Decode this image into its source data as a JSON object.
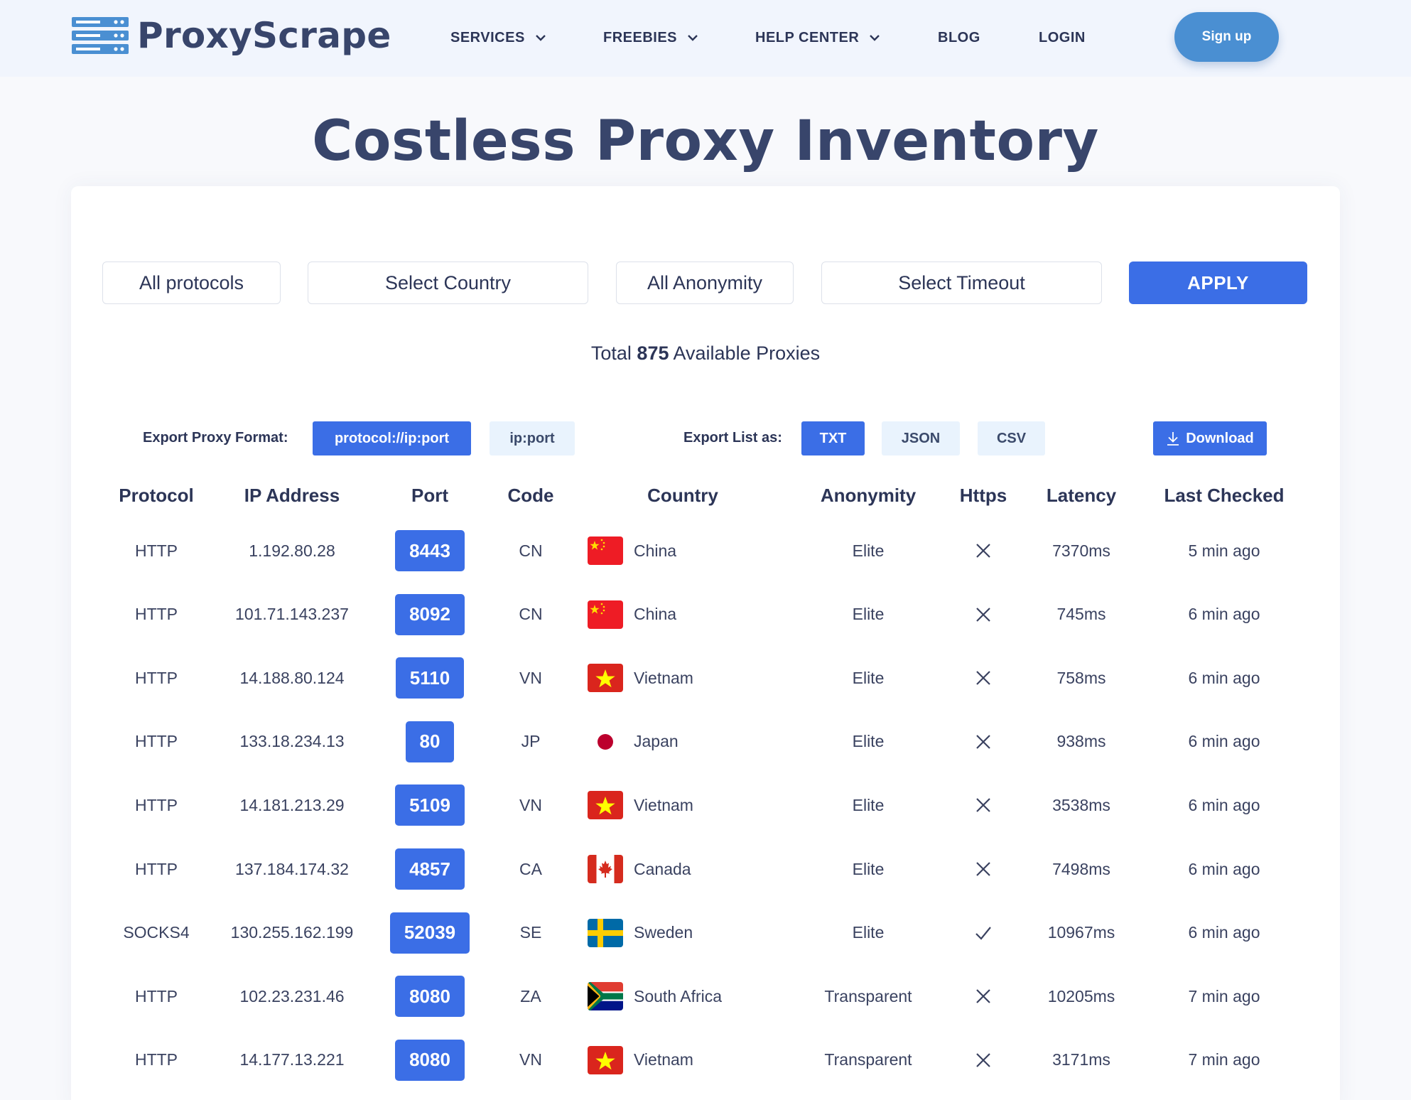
{
  "header": {
    "brand": "ProxyScrape",
    "nav": [
      {
        "label": "SERVICES",
        "has_dropdown": true
      },
      {
        "label": "FREEBIES",
        "has_dropdown": true
      },
      {
        "label": "HELP CENTER",
        "has_dropdown": true
      },
      {
        "label": "BLOG",
        "has_dropdown": false
      },
      {
        "label": "LOGIN",
        "has_dropdown": false
      }
    ],
    "signup_label": "Sign up"
  },
  "page": {
    "title": "Costless Proxy Inventory"
  },
  "filters": {
    "protocol": "All protocols",
    "country": "Select Country",
    "anonymity": "All Anonymity",
    "timeout": "Select Timeout",
    "apply_label": "APPLY"
  },
  "summary": {
    "prefix": "Total",
    "count": "875",
    "suffix": "Available Proxies"
  },
  "export": {
    "format_label": "Export Proxy Format:",
    "formats": [
      {
        "label": "protocol://ip:port",
        "active": true
      },
      {
        "label": "ip:port",
        "active": false
      }
    ],
    "list_label": "Export List as:",
    "types": [
      {
        "label": "TXT",
        "active": true
      },
      {
        "label": "JSON",
        "active": false
      },
      {
        "label": "CSV",
        "active": false
      }
    ],
    "download_label": "Download"
  },
  "table": {
    "columns": [
      "Protocol",
      "IP Address",
      "Port",
      "Code",
      "Country",
      "Anonymity",
      "Https",
      "Latency",
      "Last Checked"
    ],
    "rows": [
      {
        "protocol": "HTTP",
        "ip": "1.192.80.28",
        "port": "8443",
        "code": "CN",
        "country": "China",
        "anonymity": "Elite",
        "https": false,
        "latency": "7370ms",
        "checked": "5 min ago"
      },
      {
        "protocol": "HTTP",
        "ip": "101.71.143.237",
        "port": "8092",
        "code": "CN",
        "country": "China",
        "anonymity": "Elite",
        "https": false,
        "latency": "745ms",
        "checked": "6 min ago"
      },
      {
        "protocol": "HTTP",
        "ip": "14.188.80.124",
        "port": "5110",
        "code": "VN",
        "country": "Vietnam",
        "anonymity": "Elite",
        "https": false,
        "latency": "758ms",
        "checked": "6 min ago"
      },
      {
        "protocol": "HTTP",
        "ip": "133.18.234.13",
        "port": "80",
        "code": "JP",
        "country": "Japan",
        "anonymity": "Elite",
        "https": false,
        "latency": "938ms",
        "checked": "6 min ago"
      },
      {
        "protocol": "HTTP",
        "ip": "14.181.213.29",
        "port": "5109",
        "code": "VN",
        "country": "Vietnam",
        "anonymity": "Elite",
        "https": false,
        "latency": "3538ms",
        "checked": "6 min ago"
      },
      {
        "protocol": "HTTP",
        "ip": "137.184.174.32",
        "port": "4857",
        "code": "CA",
        "country": "Canada",
        "anonymity": "Elite",
        "https": false,
        "latency": "7498ms",
        "checked": "6 min ago"
      },
      {
        "protocol": "SOCKS4",
        "ip": "130.255.162.199",
        "port": "52039",
        "code": "SE",
        "country": "Sweden",
        "anonymity": "Elite",
        "https": true,
        "latency": "10967ms",
        "checked": "6 min ago"
      },
      {
        "protocol": "HTTP",
        "ip": "102.23.231.46",
        "port": "8080",
        "code": "ZA",
        "country": "South Africa",
        "anonymity": "Transparent",
        "https": false,
        "latency": "10205ms",
        "checked": "7 min ago"
      },
      {
        "protocol": "HTTP",
        "ip": "14.177.13.221",
        "port": "8080",
        "code": "VN",
        "country": "Vietnam",
        "anonymity": "Transparent",
        "https": false,
        "latency": "3171ms",
        "checked": "7 min ago"
      }
    ]
  },
  "colors": {
    "primary": "#3b6ee6",
    "signup": "#4a8fd2",
    "heading": "#38456b",
    "chip_idle": "#e9f3fd"
  }
}
